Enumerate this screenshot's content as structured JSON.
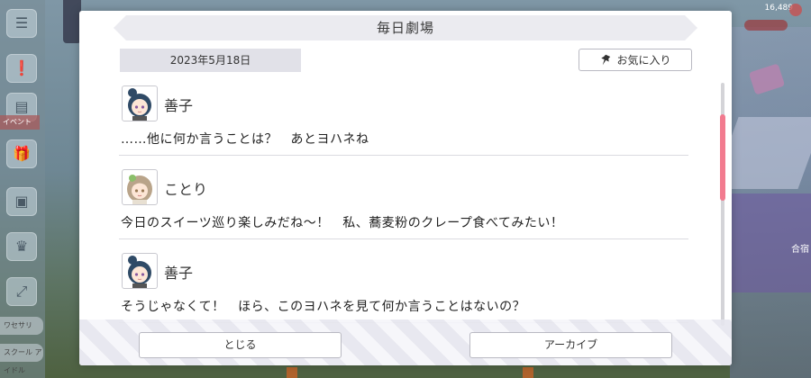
{
  "background": {
    "top_right_text": "16,489",
    "red_tag": "イベント",
    "tab_1": "ワセサリ",
    "tab_2": "スクール アイドル",
    "panel_label": "合宿"
  },
  "dialog": {
    "title": "毎日劇場",
    "date": "2023年5月18日",
    "favorite_label": "お気に入り",
    "messages": [
      {
        "speaker": "善子",
        "text": "……他に何か言うことは？　あとヨハネね"
      },
      {
        "speaker": "ことり",
        "text": "今日のスイーツ巡り楽しみだね～！　私、蕎麦粉のクレープ食べてみたい！"
      },
      {
        "speaker": "善子",
        "text": "そうじゃなくて！　ほら、このヨハネを見て何か言うことはないの？"
      }
    ],
    "close_label": "とじる",
    "archive_label": "アーカイブ"
  },
  "colors": {
    "accent_scroll": "#f27b8f",
    "title_bar": "#ebebf0",
    "date_bar": "#e1e1e8"
  }
}
